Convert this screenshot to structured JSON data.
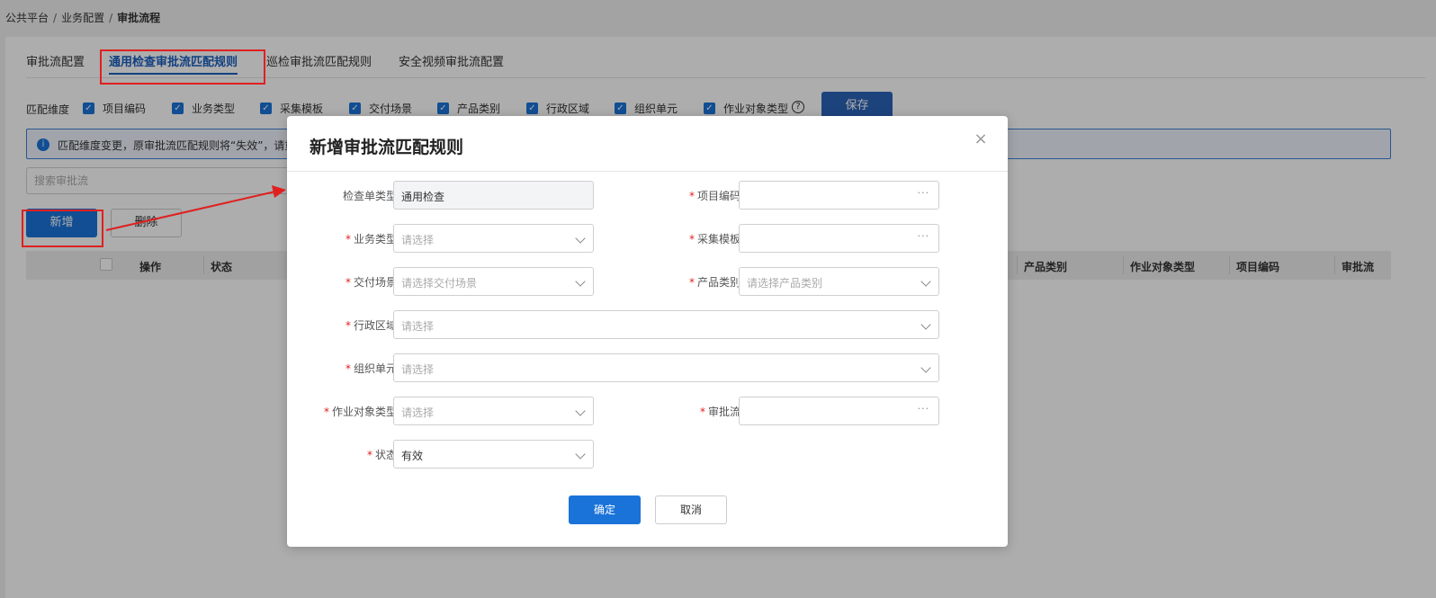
{
  "breadcrumb": {
    "item1": "公共平台",
    "item2": "业务配置",
    "current": "审批流程",
    "sep": "/"
  },
  "tabs": [
    "审批流配置",
    "通用检查审批流匹配规则",
    "巡检审批流匹配规则",
    "安全视频审批流配置"
  ],
  "dimensions": {
    "label": "匹配维度",
    "items": [
      "项目编码",
      "业务类型",
      "采集模板",
      "交付场景",
      "产品类别",
      "行政区域",
      "组织单元",
      "作业对象类型"
    ],
    "help": "?",
    "save": "保存"
  },
  "alert": {
    "icon": "i",
    "text": "匹配维度变更，原审批流匹配规则将“失效”，请重"
  },
  "search": {
    "placeholder": "搜索审批流"
  },
  "toolbar": {
    "add": "新增",
    "delete": "删除"
  },
  "table": {
    "headers_left": [
      "操作",
      "状态"
    ],
    "headers_right": [
      "产品类别",
      "作业对象类型",
      "项目编码",
      "审批流"
    ]
  },
  "modal": {
    "title": "新增审批流匹配规则",
    "close": "×",
    "fields": {
      "check_type": {
        "label": "检查单类型",
        "value": "通用检查"
      },
      "project_code": {
        "label": "项目编码",
        "value": ""
      },
      "business_type": {
        "label": "业务类型",
        "placeholder": "请选择"
      },
      "template": {
        "label": "采集模板",
        "value": ""
      },
      "scene": {
        "label": "交付场景",
        "placeholder": "请选择交付场景"
      },
      "product": {
        "label": "产品类别",
        "placeholder": "请选择产品类别"
      },
      "region": {
        "label": "行政区域",
        "placeholder": "请选择"
      },
      "org": {
        "label": "组织单元",
        "placeholder": "请选择"
      },
      "object_type": {
        "label": "作业对象类型",
        "placeholder": "请选择"
      },
      "flow": {
        "label": "审批流",
        "value": ""
      },
      "status": {
        "label": "状态",
        "value": "有效"
      }
    },
    "ok": "确定",
    "cancel": "取消",
    "required_mark": "*",
    "lookup_dots": "···"
  },
  "colors": {
    "primary": "#1a73d9",
    "annotation": "#e02020"
  }
}
